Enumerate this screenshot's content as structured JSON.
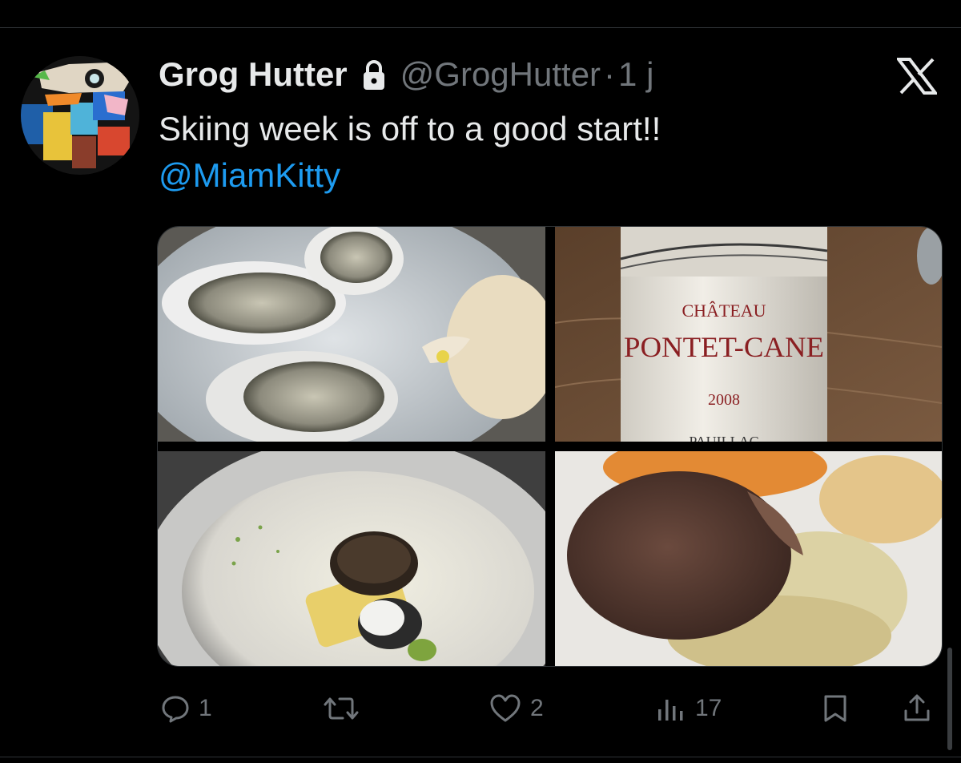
{
  "tweet": {
    "author_name": "Grog Hutter",
    "handle": "@GrogHutter",
    "separator": "·",
    "time": "1 j",
    "text": "Skiing week is off to a good start!!",
    "mention": "@MiamKitty"
  },
  "media": {
    "wine_label": {
      "chateau": "CHÂTEAU",
      "name": "PONTET-CANE",
      "year": "2008",
      "region": "PAUILLAC"
    }
  },
  "actions": {
    "reply_count": "1",
    "retweet_count": "",
    "like_count": "2",
    "views_count": "17"
  },
  "icons": [
    "lock-icon",
    "x-logo-icon",
    "reply-icon",
    "retweet-icon",
    "like-icon",
    "views-icon",
    "bookmark-icon",
    "share-icon"
  ],
  "colors": {
    "background": "#000000",
    "text": "#e7e9ea",
    "muted": "#71767b",
    "link": "#1d9bf0",
    "divider": "#2f3336"
  }
}
